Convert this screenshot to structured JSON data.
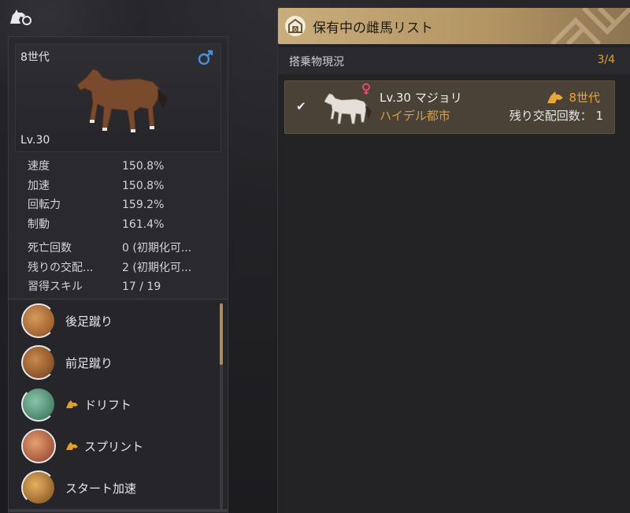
{
  "left": {
    "portrait": {
      "generation": "8世代",
      "level": "Lv.30",
      "gender_icon": "male-icon"
    },
    "stats": [
      {
        "name": "速度",
        "value": "150.8%"
      },
      {
        "name": "加速",
        "value": "150.8%"
      },
      {
        "name": "回転力",
        "value": "159.2%"
      },
      {
        "name": "制動",
        "value": "161.4%"
      }
    ],
    "info": [
      {
        "name": "死亡回数",
        "value": "0 (初期化可..."
      },
      {
        "name": "残りの交配...",
        "value": "2 (初期化可..."
      },
      {
        "name": "習得スキル",
        "value": "17 / 19"
      }
    ],
    "skills": [
      {
        "label": "後足蹴り",
        "badge": false,
        "icon": "back-kick-icon"
      },
      {
        "label": "前足蹴り",
        "badge": false,
        "icon": "front-kick-icon"
      },
      {
        "label": "ドリフト",
        "badge": true,
        "icon": "drift-icon"
      },
      {
        "label": "スプリント",
        "badge": true,
        "icon": "sprint-icon"
      },
      {
        "label": "スタート加速",
        "badge": false,
        "icon": "start-accel-icon"
      }
    ]
  },
  "right": {
    "title": "保有中の雌馬リスト",
    "status_label": "搭乗物現況",
    "status_count": "3/4",
    "entries": [
      {
        "name": "Lv.30 マジョリ",
        "location": "ハイデル都市",
        "generation": "8世代",
        "breed_count": "残り交配回数： 1",
        "checked": true,
        "gender_icon": "female-icon"
      }
    ]
  },
  "colors": {
    "accent_gold": "#e0a030",
    "title_bar": "#c9ad7b",
    "entry_bg": "#4a4137",
    "male": "#4a90d9",
    "female": "#e04a6a"
  }
}
